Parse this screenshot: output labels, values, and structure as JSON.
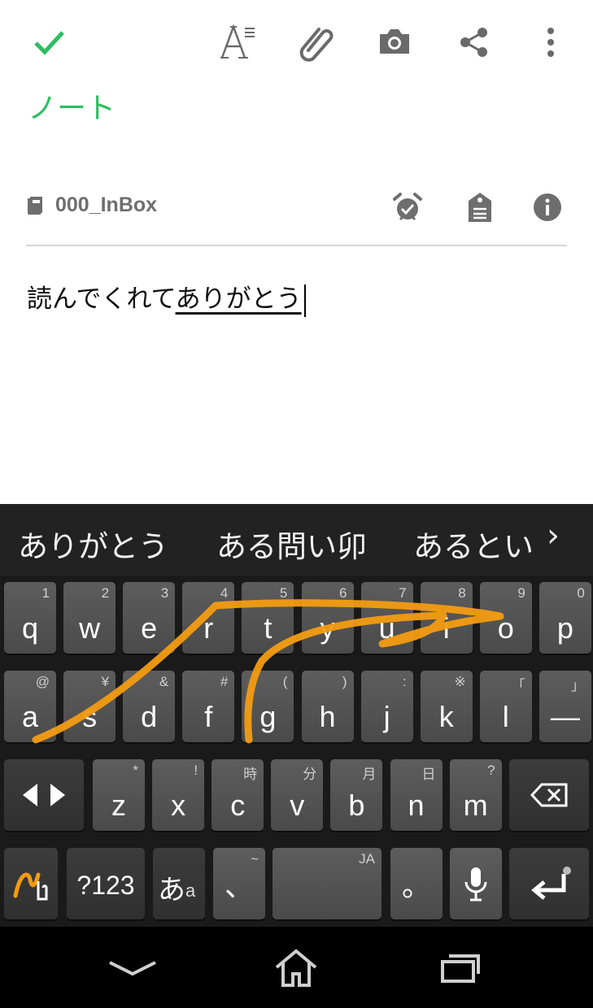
{
  "colors": {
    "accent": "#2dbe60",
    "swipe_trail": "#f39c12"
  },
  "toolbar": {
    "icons": [
      "check-icon",
      "text-format-icon",
      "attachment-icon",
      "camera-icon",
      "share-icon",
      "more-vert-icon"
    ]
  },
  "note": {
    "title": "ノート",
    "notebook": "000_InBox",
    "body_text": "読んでくれて",
    "composing_text": "ありがとう"
  },
  "meta_icons": [
    "alarm-icon",
    "tag-icon",
    "info-icon"
  ],
  "keyboard": {
    "suggestions": [
      "ありがとう",
      "ある問い卯",
      "あるとい"
    ],
    "more": "›",
    "row1": [
      {
        "k": "q",
        "h": "1"
      },
      {
        "k": "w",
        "h": "2"
      },
      {
        "k": "e",
        "h": "3"
      },
      {
        "k": "r",
        "h": "4"
      },
      {
        "k": "t",
        "h": "5"
      },
      {
        "k": "y",
        "h": "6"
      },
      {
        "k": "u",
        "h": "7"
      },
      {
        "k": "i",
        "h": "8"
      },
      {
        "k": "o",
        "h": "9"
      },
      {
        "k": "p",
        "h": "0"
      }
    ],
    "row2": [
      {
        "k": "a",
        "h": "@"
      },
      {
        "k": "s",
        "h": "¥"
      },
      {
        "k": "d",
        "h": "&"
      },
      {
        "k": "f",
        "h": "#"
      },
      {
        "k": "g",
        "h": "("
      },
      {
        "k": "h",
        "h": ")"
      },
      {
        "k": "j",
        "h": ":"
      },
      {
        "k": "k",
        "h": "※"
      },
      {
        "k": "l",
        "h": "「"
      },
      {
        "k": "—",
        "h": "」"
      }
    ],
    "row3": [
      {
        "k": "z",
        "h": "*"
      },
      {
        "k": "x",
        "h": "!"
      },
      {
        "k": "c",
        "h": "時"
      },
      {
        "k": "v",
        "h": "分"
      },
      {
        "k": "b",
        "h": "月"
      },
      {
        "k": "n",
        "h": "日"
      },
      {
        "k": "m",
        "h": "?"
      }
    ],
    "sym_key": "?123",
    "kana_key_main": "あ",
    "kana_key_sub": "a",
    "punct_key": "、",
    "punct_key_hint": "~",
    "space_hint": "JA",
    "period_key": "。"
  }
}
